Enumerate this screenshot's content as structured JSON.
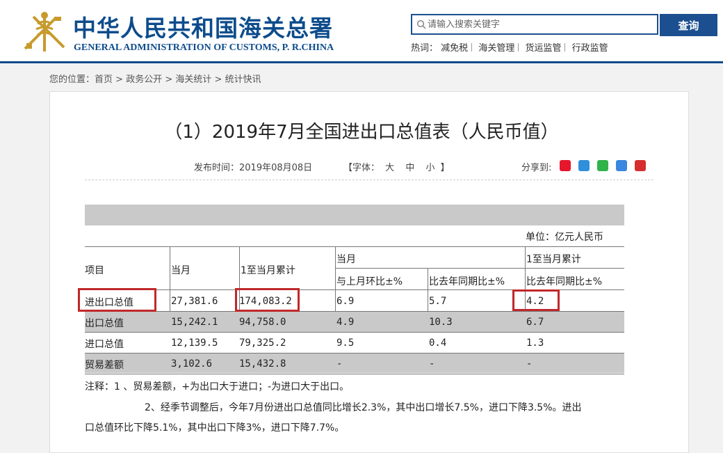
{
  "header": {
    "org_name_cn": "中华人民共和国海关总署",
    "org_name_en": "GENERAL ADMINISTRATION OF CUSTOMS, P. R.CHINA",
    "search": {
      "placeholder": "请输入搜索关键字",
      "button_label": "查询"
    },
    "hot": {
      "label": "热词：",
      "items": [
        "减免税",
        "海关管理",
        "货运监管",
        "行政监管"
      ]
    }
  },
  "breadcrumb": {
    "prefix": "您的位置：",
    "items": [
      "首页",
      "政务公开",
      "海关统计",
      "统计快讯"
    ],
    "separator": " > "
  },
  "article": {
    "title": "（1）2019年7月全国进出口总值表（人民币值）",
    "publish_time": "发布时间：2019年08月08日",
    "font_size_label": "【字体：",
    "font_sizes": [
      "大",
      "中",
      "小"
    ],
    "font_size_end": "】",
    "share_label": "分享到:",
    "share_icons": [
      "weibo-icon",
      "qzone-icon",
      "wechat-icon",
      "renren-icon",
      "people-icon"
    ]
  },
  "table": {
    "unit": "单位：亿元人民币",
    "headers": {
      "item": "项目",
      "current_month": "当月",
      "ytd": "1至当月累计",
      "current_month_group": "当月",
      "mom": "与上月环比±%",
      "yoy": "比去年同期比±%",
      "ytd_group": "1至当月累计",
      "ytd_yoy": "比去年同期比±%"
    },
    "rows": [
      {
        "item": "进出口总值",
        "current": "27,381.6",
        "ytd": "174,083.2",
        "mom": "6.9",
        "yoy": "5.7",
        "ytd_yoy": "4.2"
      },
      {
        "item": "出口总值",
        "current": "15,242.1",
        "ytd": "94,758.0",
        "mom": "4.9",
        "yoy": "10.3",
        "ytd_yoy": "6.7"
      },
      {
        "item": "进口总值",
        "current": "12,139.5",
        "ytd": "79,325.2",
        "mom": "9.5",
        "yoy": "0.4",
        "ytd_yoy": "1.3"
      },
      {
        "item": "贸易差额",
        "current": "3,102.6",
        "ytd": "15,432.8",
        "mom": "-",
        "yoy": "-",
        "ytd_yoy": "-"
      }
    ]
  },
  "notes": {
    "line1": "注释：1 、贸易差额，+为出口大于进口；-为进口大于出口。",
    "line2": "2、经季节调整后，今年7月份进出口总值同比增长2.3%，其中出口增长7.5%，进口下降3.5%。进出",
    "line3": "口总值环比下降5.1%，其中出口下降3%，进口下降7.7%。"
  },
  "colors": {
    "brand": "#0d4c8c",
    "highlight": "#c0282a",
    "stripe": "#c9c9c9"
  }
}
